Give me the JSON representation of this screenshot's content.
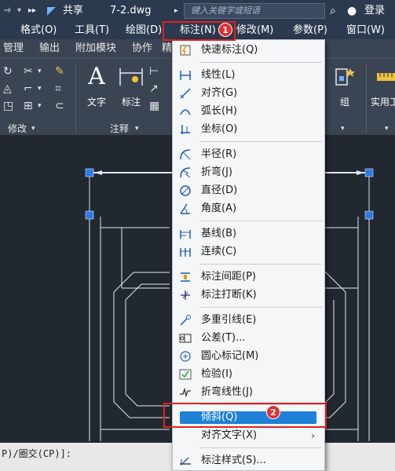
{
  "titlebar": {
    "share_label": "共享",
    "filename": "7-2.dwg",
    "search_placeholder": "键入关键字或短语",
    "login_label": "登录"
  },
  "menubar": {
    "items": [
      "格式(O)",
      "工具(T)",
      "绘图(D)",
      "标注(N)",
      "修改(M)",
      "参数(P)",
      "窗口(W)"
    ]
  },
  "ribbon": {
    "tabs": [
      "管理",
      "输出",
      "附加模块",
      "协作",
      "精"
    ],
    "panel_modify": "修改",
    "panel_annotation": "注释",
    "text_label": "文字",
    "dim_label": "标注",
    "group_label": "组",
    "utility_label": "实用工"
  },
  "dropdown": {
    "items": [
      "快速标注(Q)",
      "线性(L)",
      "对齐(G)",
      "弧长(H)",
      "坐标(O)",
      "半径(R)",
      "折弯(J)",
      "直径(D)",
      "角度(A)",
      "基线(B)",
      "连续(C)",
      "标注间距(P)",
      "标注打断(K)",
      "多重引线(E)",
      "公差(T)...",
      "圆心标记(M)",
      "检验(I)",
      "折弯线性(J)",
      "倾斜(Q)",
      "对齐文字(X)",
      "标注样式(S)..."
    ],
    "submenu_arrow": "›"
  },
  "annotations": {
    "badge1": "1",
    "badge2": "2"
  },
  "commandline": {
    "text": "P)/圈交(CP)]:"
  },
  "colors": {
    "accent": "#1e80d6",
    "annotation": "#e02020",
    "titlebar": "#2b3a4f",
    "canvas": "#212830"
  }
}
